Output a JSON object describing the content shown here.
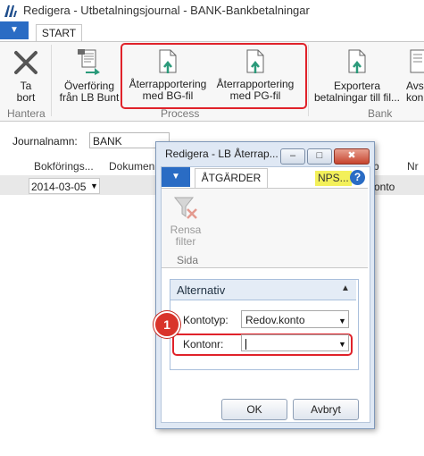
{
  "window": {
    "title": "Redigera - Utbetalningsjournal - BANK-Bankbetalningar",
    "app_menu_glyph": "▼"
  },
  "ribbon": {
    "tab": "START",
    "buttons": {
      "ta_bort": [
        "Ta",
        "bort"
      ],
      "overforing": [
        "Överföring",
        "från LB Bunt"
      ],
      "aterrapp_bg": [
        "Återrapportering",
        "med BG-fil"
      ],
      "aterrapp_pg": [
        "Återrapportering",
        "med PG-fil"
      ],
      "exportera": [
        "Exportera",
        "betalningar till fil..."
      ],
      "avs": [
        "Avs",
        "kon"
      ]
    },
    "groups": {
      "hantera": "Hantera",
      "process": "Process",
      "bank": "Bank"
    }
  },
  "page": {
    "journal_label": "Journalnamn:",
    "journal_value": "BANK",
    "columns": [
      "Bokförings...",
      "Dokumen",
      "b",
      "Nr"
    ],
    "row": {
      "date": "2014-03-05",
      "fragment": "onto"
    }
  },
  "dialog": {
    "title": "Redigera - LB Återrap...",
    "buttons": {
      "minimize": "–",
      "restore": "□",
      "close": "✖"
    },
    "menu_glyph": "▼",
    "tab": "ÅTGÄRDER",
    "nps": "NPS...",
    "help": "?",
    "rensa_filter": [
      "Rensa",
      "filter"
    ],
    "group_label": "Sida",
    "fasttab": {
      "title": "Alternativ",
      "kontotyp_label": "Kontotyp:",
      "kontotyp_value": "Redov.konto",
      "kontonr_label": "Kontonr:",
      "kontonr_value": ""
    },
    "ok": "OK",
    "cancel": "Avbryt"
  },
  "callout": {
    "number": "1",
    "color": "#d9342b"
  },
  "colors": {
    "accent": "#2a6cc4",
    "highlight": "#e0222a",
    "nps_badge": "#f3f05a"
  }
}
